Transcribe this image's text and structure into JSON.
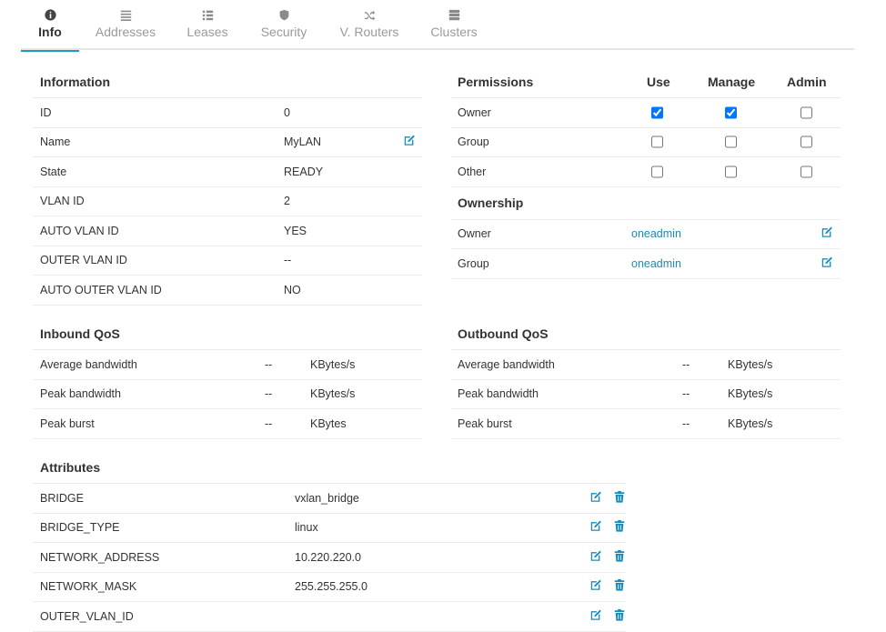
{
  "tabs": [
    {
      "label": "Info",
      "icon": "info-circle-icon"
    },
    {
      "label": "Addresses",
      "icon": "list-icon"
    },
    {
      "label": "Leases",
      "icon": "list-bullets-icon"
    },
    {
      "label": "Security",
      "icon": "shield-icon"
    },
    {
      "label": "V. Routers",
      "icon": "random-icon"
    },
    {
      "label": "Clusters",
      "icon": "server-icon"
    }
  ],
  "information": {
    "title": "Information",
    "rows": [
      {
        "label": "ID",
        "value": "0"
      },
      {
        "label": "Name",
        "value": "MyLAN"
      },
      {
        "label": "State",
        "value": "READY"
      },
      {
        "label": "VLAN ID",
        "value": "2"
      },
      {
        "label": "AUTO VLAN ID",
        "value": "YES"
      },
      {
        "label": "OUTER VLAN ID",
        "value": "--"
      },
      {
        "label": "AUTO OUTER VLAN ID",
        "value": "NO"
      }
    ]
  },
  "permissions": {
    "title": "Permissions",
    "columns": [
      "Use",
      "Manage",
      "Admin"
    ],
    "rows": [
      {
        "label": "Owner",
        "use": true,
        "manage": true,
        "admin": false
      },
      {
        "label": "Group",
        "use": false,
        "manage": false,
        "admin": false
      },
      {
        "label": "Other",
        "use": false,
        "manage": false,
        "admin": false
      }
    ]
  },
  "ownership": {
    "title": "Ownership",
    "rows": [
      {
        "label": "Owner",
        "value": "oneadmin"
      },
      {
        "label": "Group",
        "value": "oneadmin"
      }
    ]
  },
  "inbound_qos": {
    "title": "Inbound QoS",
    "rows": [
      {
        "label": "Average bandwidth",
        "value": "--",
        "unit": "KBytes/s"
      },
      {
        "label": "Peak bandwidth",
        "value": "--",
        "unit": "KBytes/s"
      },
      {
        "label": "Peak burst",
        "value": "--",
        "unit": "KBytes"
      }
    ]
  },
  "outbound_qos": {
    "title": "Outbound QoS",
    "rows": [
      {
        "label": "Average bandwidth",
        "value": "--",
        "unit": "KBytes/s"
      },
      {
        "label": "Peak bandwidth",
        "value": "--",
        "unit": "KBytes/s"
      },
      {
        "label": "Peak burst",
        "value": "--",
        "unit": "KBytes/s"
      }
    ]
  },
  "attributes": {
    "title": "Attributes",
    "rows": [
      {
        "key": "BRIDGE",
        "value": "vxlan_bridge"
      },
      {
        "key": "BRIDGE_TYPE",
        "value": "linux"
      },
      {
        "key": "NETWORK_ADDRESS",
        "value": "10.220.220.0"
      },
      {
        "key": "NETWORK_MASK",
        "value": "255.255.255.0"
      },
      {
        "key": "OUTER_VLAN_ID",
        "value": ""
      }
    ]
  },
  "colors": {
    "accent": "#1a9bc7",
    "link": "#1a8bb8",
    "divider": "#ececec"
  }
}
